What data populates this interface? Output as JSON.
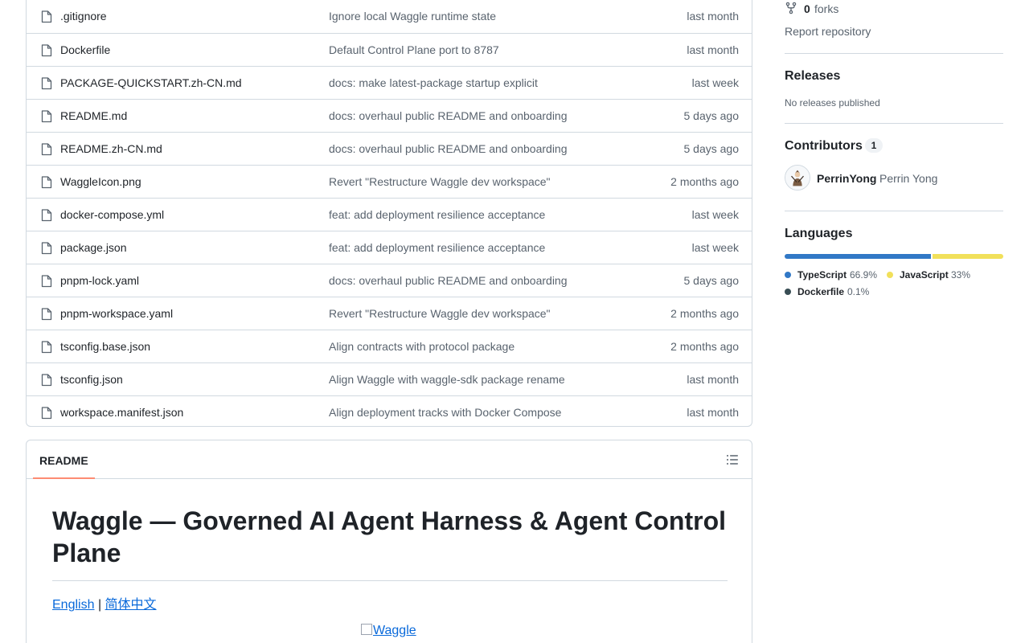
{
  "files": [
    {
      "name": ".gitignore",
      "message": "Ignore local Waggle runtime state",
      "time": "last month"
    },
    {
      "name": "Dockerfile",
      "message": "Default Control Plane port to 8787",
      "time": "last month"
    },
    {
      "name": "PACKAGE-QUICKSTART.zh-CN.md",
      "message": "docs: make latest-package startup explicit",
      "time": "last week"
    },
    {
      "name": "README.md",
      "message": "docs: overhaul public README and onboarding",
      "time": "5 days ago"
    },
    {
      "name": "README.zh-CN.md",
      "message": "docs: overhaul public README and onboarding",
      "time": "5 days ago"
    },
    {
      "name": "WaggleIcon.png",
      "message": "Revert \"Restructure Waggle dev workspace\"",
      "time": "2 months ago"
    },
    {
      "name": "docker-compose.yml",
      "message": "feat: add deployment resilience acceptance",
      "time": "last week"
    },
    {
      "name": "package.json",
      "message": "feat: add deployment resilience acceptance",
      "time": "last week"
    },
    {
      "name": "pnpm-lock.yaml",
      "message": "docs: overhaul public README and onboarding",
      "time": "5 days ago"
    },
    {
      "name": "pnpm-workspace.yaml",
      "message": "Revert \"Restructure Waggle dev workspace\"",
      "time": "2 months ago"
    },
    {
      "name": "tsconfig.base.json",
      "message": "Align contracts with protocol package",
      "time": "2 months ago"
    },
    {
      "name": "tsconfig.json",
      "message": "Align Waggle with waggle-sdk package rename",
      "time": "last month"
    },
    {
      "name": "workspace.manifest.json",
      "message": "Align deployment tracks with Docker Compose",
      "time": "last month"
    }
  ],
  "readme": {
    "tab_label": "README",
    "title": "Waggle — Governed AI Agent Harness & Agent Control Plane",
    "lang_english": "English",
    "lang_separator": "|",
    "lang_chinese": "简体中文",
    "image_alt": "Waggle",
    "outline_icon": "list-unordered-icon"
  },
  "sidebar": {
    "forks_count": "0",
    "forks_label": "forks",
    "report_label": "Report repository",
    "releases_title": "Releases",
    "releases_note": "No releases published",
    "contributors_title": "Contributors",
    "contributors_count": "1",
    "contributor_login": "PerrinYong",
    "contributor_name": "Perrin Yong",
    "languages_title": "Languages",
    "languages": [
      {
        "name": "TypeScript",
        "percent": "66.9%",
        "share": 66.9,
        "color": "#3178c6"
      },
      {
        "name": "JavaScript",
        "percent": "33%",
        "share": 33.0,
        "color": "#f1e05a"
      },
      {
        "name": "Dockerfile",
        "percent": "0.1%",
        "share": 0.1,
        "color": "#384d54"
      }
    ]
  }
}
